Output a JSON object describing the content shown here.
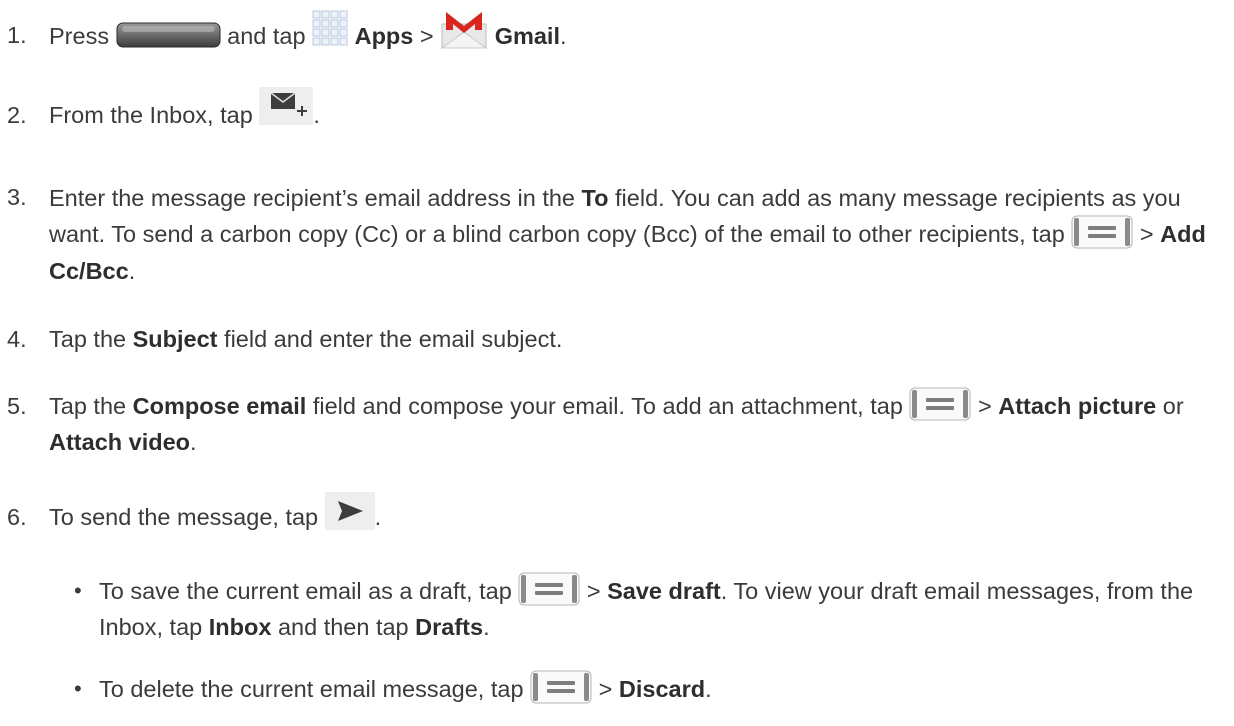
{
  "steps": [
    {
      "num": "1.",
      "parts": [
        "Press",
        "and tap",
        "Apps",
        ">",
        "Gmail",
        "."
      ]
    },
    {
      "num": "2.",
      "parts": [
        "From the Inbox, tap",
        "."
      ]
    },
    {
      "num": "3.",
      "parts": [
        "Enter the message recipient’s email address in the",
        "To",
        "field. You can add as many message recipients as you want. To send a carbon copy (Cc) or a blind carbon copy (Bcc) of the email to other recipients, tap",
        ">",
        "Add Cc/Bcc",
        "."
      ]
    },
    {
      "num": "4.",
      "parts": [
        "Tap the",
        "Subject",
        "field and enter the email subject."
      ]
    },
    {
      "num": "5.",
      "parts": [
        "Tap the",
        "Compose email",
        "field and compose your email. To add an attachment, tap",
        ">",
        "Attach picture",
        "or",
        "Attach video",
        "."
      ]
    },
    {
      "num": "6.",
      "parts": [
        "To send the message, tap",
        "."
      ]
    }
  ],
  "bullets": [
    {
      "parts": [
        "To save the current email as a draft, tap",
        ">",
        "Save draft",
        ". To view your draft email messages, from the Inbox, tap",
        "Inbox",
        "and then tap",
        "Drafts",
        "."
      ]
    },
    {
      "parts": [
        "To delete the current email message, tap",
        ">",
        "Discard",
        "."
      ]
    }
  ],
  "bullet_char": "•",
  "icons": [
    "home-key-icon",
    "apps-grid-icon",
    "gmail-icon",
    "compose-icon",
    "menu-key-icon",
    "send-icon"
  ]
}
